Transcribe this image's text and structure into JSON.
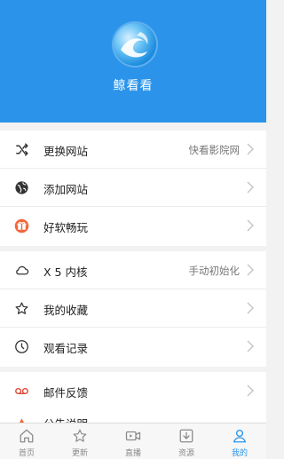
{
  "header": {
    "app_name": "鲸看看",
    "background": "#2b94ea"
  },
  "groups": [
    [
      {
        "icon": "shuffle-icon",
        "label": "更换网站",
        "value": "快看影院网"
      },
      {
        "icon": "globe-icon",
        "label": "添加网站",
        "value": ""
      },
      {
        "icon": "gift-icon",
        "label": "好软畅玩",
        "value": ""
      }
    ],
    [
      {
        "icon": "cloud-icon",
        "label": "X 5 内核",
        "value": "手动初始化"
      },
      {
        "icon": "star-icon",
        "label": "我的收藏",
        "value": ""
      },
      {
        "icon": "clock-icon",
        "label": "观看记录",
        "value": ""
      }
    ],
    [
      {
        "icon": "voicemail-icon",
        "label": "邮件反馈",
        "value": ""
      }
    ]
  ],
  "partial_item": {
    "icon": "info-icon",
    "label": "公告说明"
  },
  "tabbar": {
    "items": [
      {
        "icon": "home-icon",
        "label": "首页"
      },
      {
        "icon": "star-outline-icon",
        "label": "更新"
      },
      {
        "icon": "video-icon",
        "label": "直播"
      },
      {
        "icon": "download-icon",
        "label": "资源"
      },
      {
        "icon": "person-icon",
        "label": "我的"
      }
    ],
    "active_index": 4,
    "active_color": "#2b94ea"
  }
}
